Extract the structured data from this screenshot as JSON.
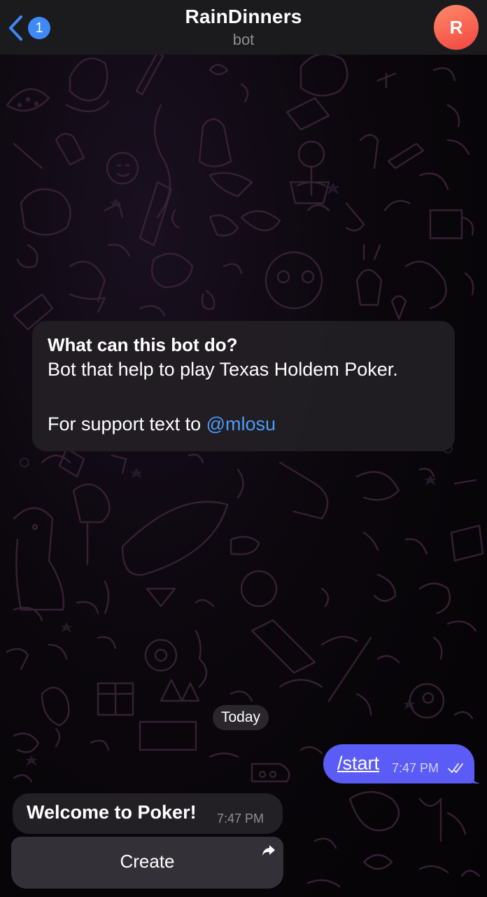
{
  "header": {
    "back_badge": "1",
    "title": "RainDinners",
    "subtitle": "bot",
    "avatar_letter": "R",
    "avatar_color": "#f2453e"
  },
  "bot_info": {
    "heading": "What can this bot do?",
    "description": "Bot that help to play Texas Holdem Poker.",
    "support_prefix": "For support text to ",
    "support_handle": "@mlosu"
  },
  "date_separator": "Today",
  "messages": [
    {
      "direction": "outgoing",
      "text": "/start",
      "time": "7:47 PM",
      "status": "read"
    },
    {
      "direction": "incoming",
      "text": "Welcome to Poker!",
      "time": "7:47 PM"
    }
  ],
  "inline_keyboard": [
    {
      "label": "Create",
      "icon": "share-arrow-icon"
    }
  ],
  "colors": {
    "outgoing_bubble": "#5a5cf5",
    "accent": "#3e88f7",
    "link": "#4f9bf7"
  }
}
